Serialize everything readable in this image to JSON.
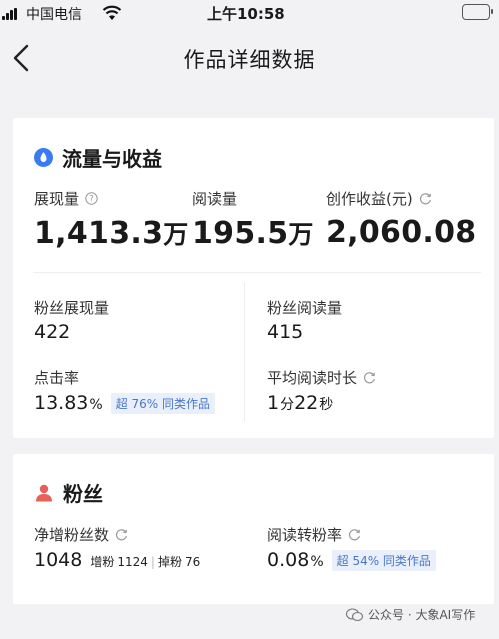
{
  "status_bar": {
    "carrier": "中国电信",
    "time": "上午10:58"
  },
  "nav": {
    "title": "作品详细数据"
  },
  "flow_section": {
    "title": "流量与收益",
    "impressions": {
      "label": "展现量",
      "value": "1,413.3",
      "unit": "万"
    },
    "reads": {
      "label": "阅读量",
      "value": "195.5",
      "unit": "万"
    },
    "earnings": {
      "label": "创作收益(元)",
      "value": "2,060.08"
    },
    "fan_impressions": {
      "label": "粉丝展现量",
      "value": "422"
    },
    "fan_reads": {
      "label": "粉丝阅读量",
      "value": "415"
    },
    "ctr": {
      "label": "点击率",
      "value": "13.83",
      "unit": "%",
      "badge": "超 76% 同类作品"
    },
    "avg_read_time": {
      "label": "平均阅读时长",
      "value_min": "1",
      "unit_min": "分",
      "value_sec": "22",
      "unit_sec": "秒"
    }
  },
  "fans_section": {
    "title": "粉丝",
    "net_fans": {
      "label": "净增粉丝数",
      "value": "1048",
      "gain_label": "增粉",
      "gain_value": "1124",
      "sep": "|",
      "loss_label": "掉粉",
      "loss_value": "76"
    },
    "conversion": {
      "label": "阅读转粉率",
      "value": "0.08",
      "unit": "%",
      "badge": "超 54% 同类作品"
    }
  },
  "watermark": {
    "text": "公众号 · 大象AI写作"
  },
  "colors": {
    "accent_blue": "#3a7bf4",
    "fan_icon": "#e8605a",
    "badge_text": "#4a76c9",
    "badge_bg": "#e9f0fc"
  },
  "icons": [
    "signal-icon",
    "wifi-icon",
    "battery-icon",
    "back-icon",
    "flow-icon",
    "fan-icon",
    "question-icon",
    "refresh-icon",
    "wechat-icon"
  ]
}
